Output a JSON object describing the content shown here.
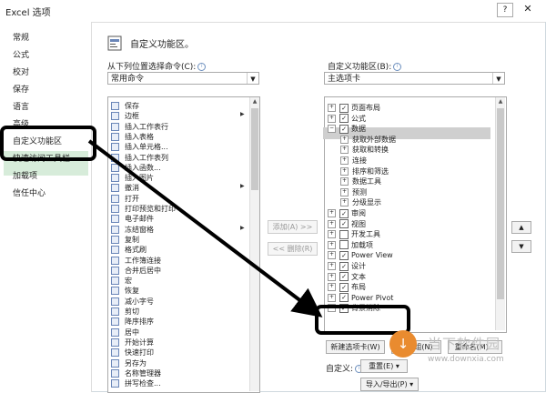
{
  "window": {
    "title": "Excel 选项",
    "help": "?",
    "close": "✕"
  },
  "sidebar": {
    "items": [
      {
        "label": "常规",
        "selected": false
      },
      {
        "label": "公式",
        "selected": false
      },
      {
        "label": "校对",
        "selected": false
      },
      {
        "label": "保存",
        "selected": false
      },
      {
        "label": "语言",
        "selected": false
      },
      {
        "label": "高级",
        "selected": false
      },
      {
        "label": "自定义功能区",
        "selected": true
      },
      {
        "label": "快速访问工具栏",
        "selected": false
      },
      {
        "label": "加载项",
        "selected": false
      },
      {
        "label": "信任中心",
        "selected": false
      }
    ]
  },
  "main": {
    "heading": "自定义功能区。",
    "left_label": "从下列位置选择命令(C):",
    "left_dropdown": "常用命令",
    "right_label": "自定义功能区(B):",
    "right_dropdown": "主选项卡",
    "commands": [
      {
        "label": "保存",
        "submenu": false
      },
      {
        "label": "边框",
        "submenu": true
      },
      {
        "label": "插入工作表行",
        "submenu": false
      },
      {
        "label": "插入表格",
        "submenu": false
      },
      {
        "label": "插入单元格...",
        "submenu": false
      },
      {
        "label": "插入工作表列",
        "submenu": false
      },
      {
        "label": "插入函数...",
        "submenu": false
      },
      {
        "label": "插入图片",
        "submenu": false
      },
      {
        "label": "撤消",
        "submenu": true
      },
      {
        "label": "打开",
        "submenu": false
      },
      {
        "label": "打印预览和打印",
        "submenu": false
      },
      {
        "label": "电子邮件",
        "submenu": false
      },
      {
        "label": "冻结窗格",
        "submenu": true
      },
      {
        "label": "复制",
        "submenu": false
      },
      {
        "label": "格式刷",
        "submenu": false
      },
      {
        "label": "工作簿连接",
        "submenu": false
      },
      {
        "label": "合并后居中",
        "submenu": false
      },
      {
        "label": "宏",
        "submenu": false
      },
      {
        "label": "恢复",
        "submenu": false
      },
      {
        "label": "减小字号",
        "submenu": false
      },
      {
        "label": "剪切",
        "submenu": false
      },
      {
        "label": "降序排序",
        "submenu": false
      },
      {
        "label": "居中",
        "submenu": false
      },
      {
        "label": "开始计算",
        "submenu": false
      },
      {
        "label": "快速打印",
        "submenu": false
      },
      {
        "label": "另存为",
        "submenu": false
      },
      {
        "label": "名称管理器",
        "submenu": false
      },
      {
        "label": "拼写检查...",
        "submenu": false
      }
    ],
    "add_button": "添加(A) >>",
    "remove_button": "<< 删除(R)",
    "tabs_tree": [
      {
        "label": "页面布局",
        "level": 0,
        "expander": "+",
        "checked": true
      },
      {
        "label": "公式",
        "level": 0,
        "expander": "+",
        "checked": true
      },
      {
        "label": "数据",
        "level": 0,
        "expander": "−",
        "checked": true,
        "selected": true
      },
      {
        "label": "获取外部数据",
        "level": 1,
        "expander": "+"
      },
      {
        "label": "获取和转换",
        "level": 1,
        "expander": "+"
      },
      {
        "label": "连接",
        "level": 1,
        "expander": "+"
      },
      {
        "label": "排序和筛选",
        "level": 1,
        "expander": "+"
      },
      {
        "label": "数据工具",
        "level": 1,
        "expander": "+"
      },
      {
        "label": "预测",
        "level": 1,
        "expander": "+"
      },
      {
        "label": "分级显示",
        "level": 1,
        "expander": "+"
      },
      {
        "label": "审阅",
        "level": 0,
        "expander": "+",
        "checked": true
      },
      {
        "label": "视图",
        "level": 0,
        "expander": "+",
        "checked": true
      },
      {
        "label": "开发工具",
        "level": 0,
        "expander": "+",
        "checked": false
      },
      {
        "label": "加载项",
        "level": 0,
        "expander": "+",
        "checked": false
      },
      {
        "label": "Power View",
        "level": 0,
        "expander": "+",
        "checked": true
      },
      {
        "label": "设计",
        "level": 0,
        "expander": "+",
        "checked": true
      },
      {
        "label": "文本",
        "level": 0,
        "expander": "+",
        "checked": true
      },
      {
        "label": "布局",
        "level": 0,
        "expander": "+",
        "checked": true
      },
      {
        "label": "Power Pivot",
        "level": 0,
        "expander": "+",
        "checked": true
      },
      {
        "label": "背景消除",
        "level": 0,
        "expander": "+",
        "checked": true
      }
    ],
    "new_tab_button": "新建选项卡(W)",
    "new_group_button": "新建组(N)",
    "rename_button": "重命名(M)...",
    "customize_label": "自定义:",
    "reset_button": "重置(E) ▾",
    "import_export_button": "导入/导出(P) ▾",
    "move_up": "▲",
    "move_down": "▼"
  },
  "watermark": {
    "text": "当下软件园",
    "url": "www.downxia.com",
    "logo_char": "↓"
  },
  "colors": {
    "selected_nav": "#d7ecda",
    "highlight": "#000000",
    "watermark_orange": "#e98b2f"
  }
}
